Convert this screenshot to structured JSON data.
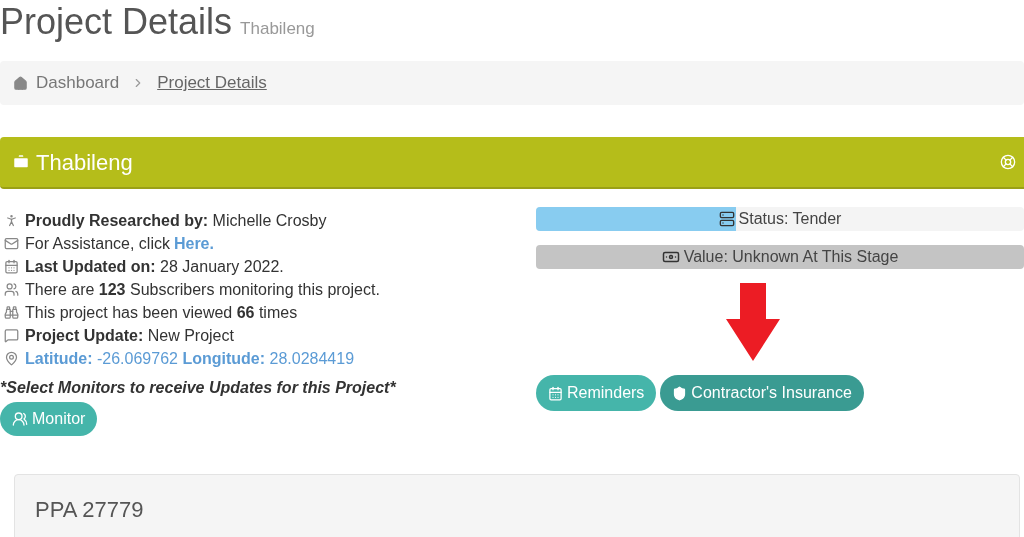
{
  "page_title": "Project Details",
  "page_subtitle": "Thabileng",
  "breadcrumb": [
    {
      "label": "Dashboard",
      "kind": "home"
    },
    {
      "label": "Project Details",
      "kind": "link"
    }
  ],
  "panel": {
    "title": "Thabileng"
  },
  "info_lines": [
    {
      "kind": "person",
      "text": "**Proudly Researched by:** Michelle Crosby"
    },
    {
      "kind": "mail",
      "text": "For Assistance, click",
      "link": "Here."
    },
    {
      "kind": "calendar",
      "text": "**Last Updated on:** 28 January 2022."
    },
    {
      "kind": "users",
      "text": "There are **123** Subscribers monitoring this project."
    },
    {
      "kind": "binoculars",
      "text": "This project has been viewed **66** times"
    },
    {
      "kind": "comment",
      "text": "**Project Update:** New Project"
    },
    {
      "kind": "location",
      "text": "**Latitude:** -26.069762 **Longitude:** 28.0284419"
    }
  ],
  "monitor_note": "*Select Monitors to receive Updates for this Project*",
  "monitor_button": "Monitor",
  "bars": [
    {
      "kind": "status",
      "label": "Status: Tender",
      "level": 0.41
    },
    {
      "kind": "value",
      "label": "Value: Unknown At This Stage"
    }
  ],
  "buttons": [
    {
      "kind": "calendar",
      "label": "Reminders"
    },
    {
      "kind": "shield",
      "label": "Contractor's Insurance"
    }
  ],
  "card": {
    "title": "PPA 27779"
  }
}
